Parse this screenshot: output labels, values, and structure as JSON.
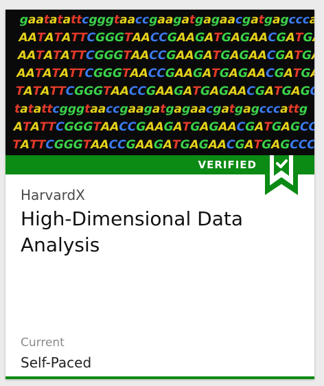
{
  "card": {
    "image_alt": "DNA sequence letters on black background",
    "badge_label": "VERIFIED",
    "badge_icon": "checkmark-ribbon-icon",
    "org": "HarvardX",
    "title": "High-Dimensional Data Analysis",
    "status": "Current",
    "pacing": "Self-Paced"
  },
  "colors": {
    "verified_green": "#0b8a14",
    "hero_background": "#0a0a0a",
    "dna_yellow": "#e6d21a",
    "dna_green": "#3bd24a",
    "dna_blue": "#3b7bf0",
    "dna_red": "#e23a2a"
  },
  "dna_lines": [
    "gaatatattcgggtaaccgaagatgagaacgatgagccca",
    "AATATATTCGGGTAACCGAAGATGAGAACGATGAGCCCA",
    "AATATATTCGGGTAACCGAAGATGAGAACGATGAGCCCAT",
    "AATATATTCGGGTAACCGAAGATGAGAACGATGAGCCCATT",
    "TATATTCGGGTAACCGAAGATGAGAACGATGAGCCCATTG",
    "tatattcgggtaaccgaagatgagaacgatgagcccattg",
    "ATATTCGGGTAACCGAAGATGAGAACGATGAGCCCATTGA",
    "TATTCGGGTAACCGAAGATGAGAACGATGAGCCCATTGAT"
  ]
}
